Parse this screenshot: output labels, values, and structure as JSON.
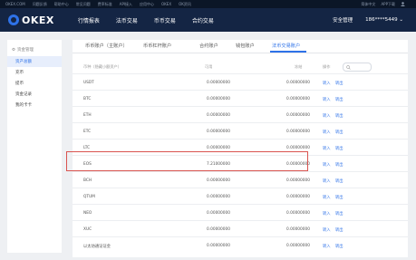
{
  "topbar": {
    "left_items": [
      "OKEX.COM",
      "问题反馈",
      "帮助中心",
      "常见问题",
      "费率标准",
      "API接入",
      "应用中心",
      "OKEX",
      "OK资讯"
    ],
    "right_items": [
      "简体中文",
      "APP下载"
    ]
  },
  "nav": {
    "logo_text": "OKEX",
    "links": [
      "行情报表",
      "法币交易",
      "币币交易",
      "合约交易"
    ],
    "security": "安全管理",
    "account": "186****5449"
  },
  "sidebar": {
    "title": "资金管理",
    "items": [
      "资产总额",
      "充币",
      "提币",
      "资金记录",
      "我的卡卡"
    ]
  },
  "tabs": [
    "币币账户（主账户）",
    "币币杠杆账户",
    "合约账户",
    "钱包账户",
    "法币交易账户"
  ],
  "table": {
    "headers": [
      "币种（隐藏小额资产）",
      "可用",
      "冻结",
      "操作"
    ],
    "rows": [
      {
        "coin": "USDT",
        "available": "0.00000000",
        "frozen": "0.00000000",
        "a1": "转入",
        "a2": "转出"
      },
      {
        "coin": "BTC",
        "available": "0.00000000",
        "frozen": "0.00000000",
        "a1": "转入",
        "a2": "转出"
      },
      {
        "coin": "ETH",
        "available": "0.00000000",
        "frozen": "0.00000000",
        "a1": "转入",
        "a2": "转出"
      },
      {
        "coin": "ETC",
        "available": "0.00000000",
        "frozen": "0.00000000",
        "a1": "转入",
        "a2": "转出"
      },
      {
        "coin": "LTC",
        "available": "0.00000000",
        "frozen": "0.00000000",
        "a1": "转入",
        "a2": "转出"
      },
      {
        "coin": "EOS",
        "available": "7.21000000",
        "frozen": "0.00000000",
        "a1": "转入",
        "a2": "转出"
      },
      {
        "coin": "BCH",
        "available": "0.00000000",
        "frozen": "0.00000000",
        "a1": "转入",
        "a2": "转出"
      },
      {
        "coin": "QTUM",
        "available": "0.00000000",
        "frozen": "0.00000000",
        "a1": "转入",
        "a2": "转出"
      },
      {
        "coin": "NEO",
        "available": "0.00000000",
        "frozen": "0.00000000",
        "a1": "转入",
        "a2": "转出"
      },
      {
        "coin": "XUC",
        "available": "0.00000000",
        "frozen": "0.00000000",
        "a1": "转入",
        "a2": "转出"
      },
      {
        "coin": "以太坊通证证金",
        "available": "0.00000000",
        "frozen": "0.00000000",
        "a1": "转入",
        "a2": "转出"
      }
    ]
  },
  "colors": {
    "accent": "#2e72e8",
    "nav_bg": "#142544",
    "highlight": "#d9534f"
  }
}
